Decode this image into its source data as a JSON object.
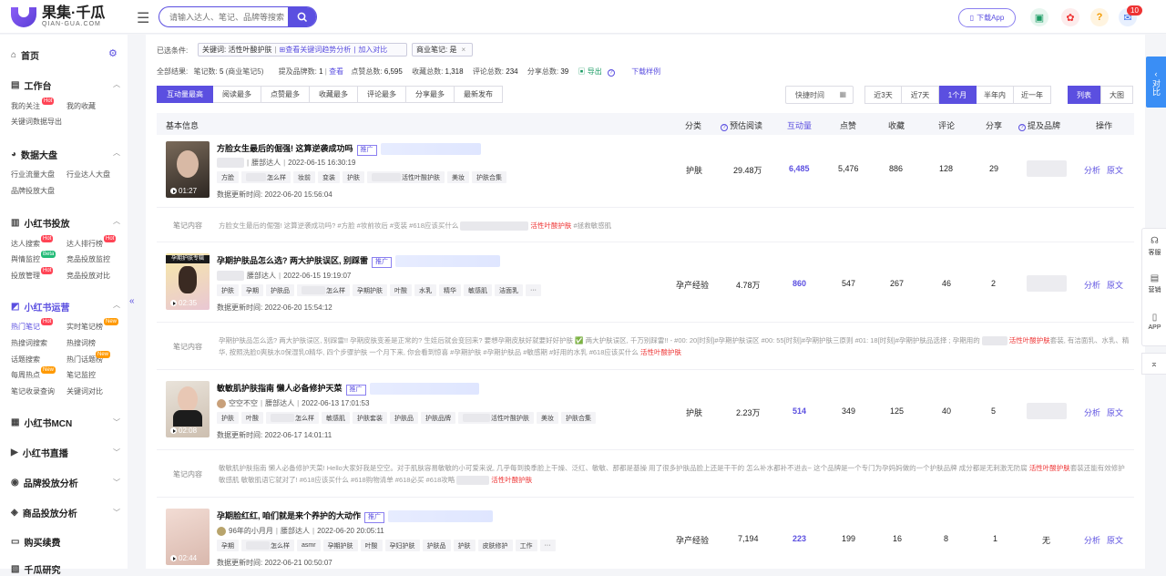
{
  "header": {
    "logo_main": "果集·千瓜",
    "logo_sub": "QIAN-GUA.COM",
    "search_placeholder": "请输入达人、笔记、品牌等搜索",
    "download_app": "下载App",
    "notif_count": "10",
    "help_icon": "?"
  },
  "sidebar": {
    "home": "首页",
    "groups": [
      {
        "title": "工作台",
        "items": [
          "我的关注",
          "我的收藏",
          "关键词数据导出"
        ]
      },
      {
        "title": "数据大盘",
        "items": [
          "行业流量大盘",
          "行业达人大盘",
          "品牌投放大盘"
        ]
      },
      {
        "title": "小红书投放",
        "items": [
          "达人搜索",
          "达人排行榜",
          "舆情监控",
          "竞品投放监控",
          "投放管理",
          "竞品投放对比"
        ]
      },
      {
        "title": "小红书运营",
        "items": [
          "热门笔记",
          "实时笔记榜",
          "热搜词搜索",
          "热搜词榜",
          "话题搜索",
          "热门话题榜",
          "每周热点",
          "笔记监控",
          "笔记收录查询",
          "关键词对比"
        ]
      },
      {
        "title": "小红书MCN"
      },
      {
        "title": "小红书直播"
      },
      {
        "title": "品牌投放分析"
      },
      {
        "title": "商品投放分析"
      },
      {
        "title": "购买续费"
      },
      {
        "title": "千瓜研究"
      }
    ],
    "tags": {
      "hot": "Hot",
      "new": "New",
      "beta": "Beta"
    }
  },
  "filters": {
    "selected_label": "已选条件:",
    "keyword_chip": "关键词: 活性叶酸护肤",
    "keyword_link": "查看关键词趋势分析",
    "keyword_add": "加入对比",
    "business_chip": "商业笔记: 是",
    "close": "×"
  },
  "stats": {
    "all_results": "全部结果:",
    "notes_label": "笔记数:",
    "notes_value": "5",
    "business_notes": "(商业笔记5)",
    "brands_label": "提及品牌数:",
    "brands_value": "1",
    "view": "查看",
    "likes_label": "点赞总数:",
    "likes_value": "6,595",
    "collects_label": "收藏总数:",
    "collects_value": "1,318",
    "comments_label": "评论总数:",
    "comments_value": "234",
    "shares_label": "分享总数:",
    "shares_value": "39",
    "export": "导出",
    "download_sample": "下载样例"
  },
  "sort_tabs": [
    "互动量最高",
    "阅读最多",
    "点赞最多",
    "收藏最多",
    "评论最多",
    "分享最多",
    "最新发布"
  ],
  "time_select": "快捷时间",
  "range_tabs": [
    "近3天",
    "近7天",
    "1个月",
    "半年内",
    "近一年"
  ],
  "view_tabs": [
    "列表",
    "大图"
  ],
  "table": {
    "headers": {
      "basic": "基本信息",
      "category": "分类",
      "est_reads": "预估阅读",
      "interactions": "互动量",
      "likes": "点赞",
      "collects": "收藏",
      "comments": "评论",
      "shares": "分享",
      "brands": "提及品牌",
      "ops": "操作"
    },
    "updated_label": "数据更新时间:",
    "promo": "推广",
    "analysis": "分析",
    "original": "原文",
    "content_label": "笔记内容",
    "rows": [
      {
        "duration": "01:27",
        "title": "方脸女生最后的倔强! 这算逆袭成功吗",
        "author_tier": "腰部达人",
        "publish_time": "2022-06-15 16:30:19",
        "tags": [
          "方脸",
          "怎么样",
          "妆前",
          "变装",
          "护肤",
          "活性叶酸护肤",
          "美妆",
          "护肤合集"
        ],
        "updated": "2022-06-20 15:56:04",
        "category": "护肤",
        "est_reads": "29.48万",
        "interactions": "6,485",
        "likes": "5,476",
        "collects": "886",
        "comments": "128",
        "shares": "29",
        "brand": "",
        "content_a": "方脸女生最后的倔强! 这算逆袭成功吗? #方脸 #妆前妆后 #变装 #618应该买什么",
        "content_hl": "活性叶酸护肤",
        "content_b": "#拯救敏感肌"
      },
      {
        "duration": "02:35",
        "title": "孕期护肤品怎么选? 两大护肤误区, 别踩雷",
        "author_tier": "腰部达人",
        "publish_time": "2022-06-15 19:19:07",
        "tags": [
          "护肤",
          "孕期",
          "护肤品",
          "怎么样",
          "孕期护肤",
          "叶酸",
          "水乳",
          "精华",
          "敏感肌",
          "洁面乳",
          "···"
        ],
        "updated": "2022-06-20 15:54:12",
        "category": "孕产经验",
        "est_reads": "4.78万",
        "interactions": "860",
        "likes": "547",
        "collects": "267",
        "comments": "46",
        "shares": "2",
        "brand": "",
        "content_a": "孕期护肤品怎么选? 两大护肤误区, 别踩雷!! 孕期皮肤变差是正常的? 生娃后就会变回来? 要想孕期皮肤好就要好好护肤 ✅ 两大护肤误区, 千万别踩雷!! - #00: 20[时刻]#孕期护肤误区 #00: 55[时刻]#孕期护肤三原则 #01: 18[时刻]#孕期护肤品选择 ; 孕期用的",
        "content_hl": "活性叶酸护肤",
        "content_b": "套装, 有洁面乳、水乳、精华, 按照洗脸0爽肤水0保湿乳0精华, 四个步骤护肤 一个月下来, 你会看到惊喜 #孕期护肤 #孕期护肤品 #敏感期 #好用的水乳 #618应该买什么",
        "content_hl2": "活性叶酸护肤"
      },
      {
        "duration": "02:08",
        "title": "敏敏肌护肤指南 懒人必备修护天菜",
        "author": "空空不空",
        "author_tier": "腰部达人",
        "publish_time": "2022-06-13 17:01:53",
        "tags": [
          "护肤",
          "叶酸",
          "怎么样",
          "敏感肌",
          "护肤套装",
          "护肤品",
          "护肤品牌",
          "活性叶酸护肤",
          "美妆",
          "护肤合集"
        ],
        "updated": "2022-06-17 14:01:11",
        "category": "护肤",
        "est_reads": "2.23万",
        "interactions": "514",
        "likes": "349",
        "collects": "125",
        "comments": "40",
        "shares": "5",
        "brand": "",
        "content_a": "敏敏肌护肤指南 懒人必备修护天菜! Hello大家好我是空空。对于肌肤容易敏敏的小可爱来说, 几乎每到换季脸上干燥、泛红、敏敏、那都是基操 用了很多护肤品脸上还是干干的 怎么补水都补不进去~ 这个品牌是一个专门为孕妈妈做的一个护肤品牌 成分都是无刺激无防腐",
        "content_hl": "活性叶酸护肤",
        "content_b": "套装还能有效修护敏感肌 敏敏肌语它就对了! #618应该买什么 #618购物清单 #618必买 #618攻略",
        "content_hl2": "活性叶酸护肤"
      },
      {
        "duration": "02:44",
        "title": "孕期脸红红, 咱们就是来个养护的大动作",
        "author": "96年的小月月",
        "author_tier": "腰部达人",
        "publish_time": "2022-06-20 20:05:11",
        "tags": [
          "孕期",
          "怎么样",
          "asmr",
          "孕期护肤",
          "叶酸",
          "孕妇护肤",
          "护肤品",
          "护肤",
          "皮肤修护",
          "工作",
          "···"
        ],
        "updated": "2022-06-21 00:50:07",
        "category": "孕产经验",
        "est_reads": "7,194",
        "interactions": "223",
        "likes": "199",
        "collects": "16",
        "comments": "8",
        "shares": "1",
        "brand": "无"
      }
    ]
  },
  "float": {
    "compare_tab": "对比",
    "service": "客服",
    "marketing": "营销",
    "app": "APP"
  }
}
